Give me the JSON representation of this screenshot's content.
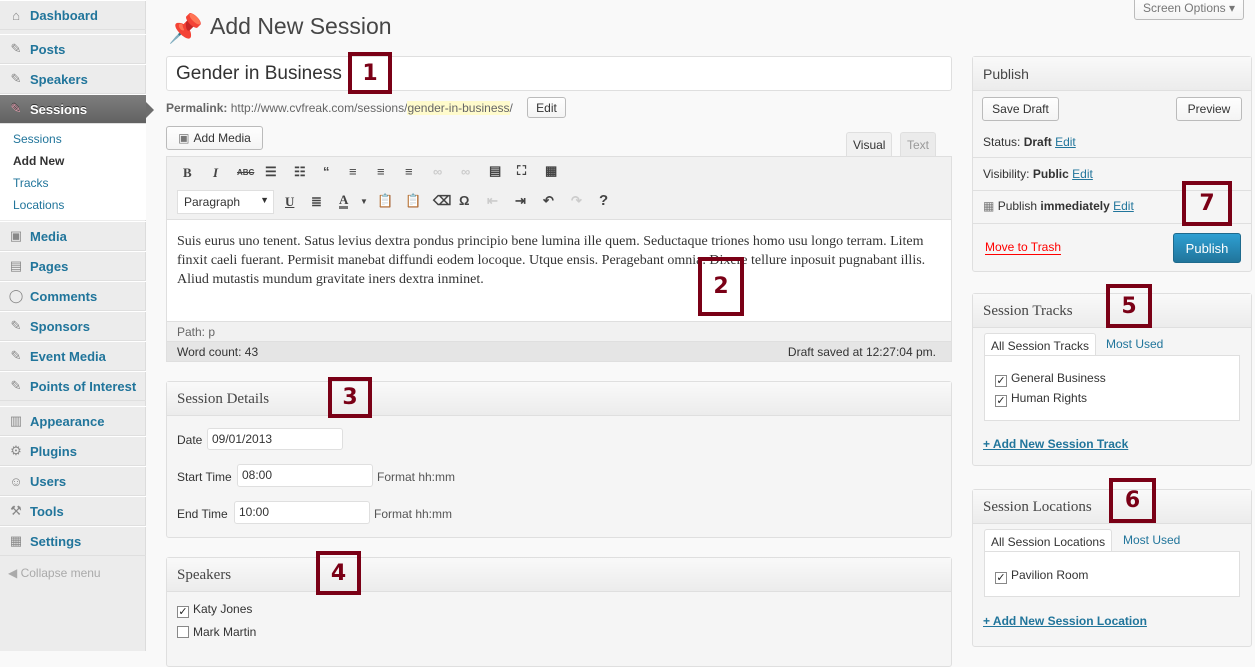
{
  "sidebar": {
    "items": [
      {
        "label": "Dashboard",
        "icon": "house-icon"
      },
      {
        "label": "Posts",
        "icon": "pin-icon"
      },
      {
        "label": "Speakers",
        "icon": "pin-icon"
      },
      {
        "label": "Sessions",
        "icon": "pin-icon"
      },
      {
        "label": "Media",
        "icon": "media-icon"
      },
      {
        "label": "Pages",
        "icon": "pages-icon"
      },
      {
        "label": "Comments",
        "icon": "comment-icon"
      },
      {
        "label": "Sponsors",
        "icon": "pin-icon"
      },
      {
        "label": "Event Media",
        "icon": "pin-icon"
      },
      {
        "label": "Points of Interest",
        "icon": "pin-icon"
      },
      {
        "label": "Appearance",
        "icon": "appearance-icon"
      },
      {
        "label": "Plugins",
        "icon": "plugin-icon"
      },
      {
        "label": "Users",
        "icon": "users-icon"
      },
      {
        "label": "Tools",
        "icon": "tools-icon"
      },
      {
        "label": "Settings",
        "icon": "settings-icon"
      }
    ],
    "submenu": [
      "Sessions",
      "Add New",
      "Tracks",
      "Locations"
    ],
    "collapse": "Collapse menu"
  },
  "header": {
    "title": "Add New Session",
    "screen_options": "Screen Options"
  },
  "post": {
    "title": "Gender in Business",
    "permalink_label": "Permalink:",
    "permalink_base": "http://www.cvfreak.com/sessions/",
    "permalink_slug": "gender-in-business",
    "permalink_end": "/",
    "edit": "Edit"
  },
  "editor": {
    "add_media": "Add Media",
    "tab_visual": "Visual",
    "tab_text": "Text",
    "format": "Paragraph",
    "content": "Suis eurus uno tenent. Satus levius dextra pondus principio bene lumina ille quem. Seductaque triones homo usu longo terram. Litem finxit caeli fuerant. Permisit manebat diffundi eodem locoque. Utque ensis. Peragebant omnia. Dixere tellure inposuit pugnabant illis. Aliud mutastis mundum gravitate iners dextra inminet.",
    "path": "Path: p",
    "word_count": "Word count: 43",
    "draft_saved": "Draft saved at 12:27:04 pm."
  },
  "session_details": {
    "title": "Session Details",
    "date_label": "Date",
    "date": "09/01/2013",
    "start_label": "Start Time",
    "start": "08:00",
    "end_label": "End Time",
    "end": "10:00",
    "format": "Format hh:mm"
  },
  "speakers": {
    "title": "Speakers",
    "items": [
      {
        "label": "Katy Jones",
        "checked": true
      },
      {
        "label": "Mark Martin",
        "checked": false
      }
    ]
  },
  "publish": {
    "title": "Publish",
    "save_draft": "Save Draft",
    "preview": "Preview",
    "status_label": "Status:",
    "status": "Draft",
    "visibility_label": "Visibility:",
    "visibility": "Public",
    "publish_label": "Publish",
    "publish_when": "immediately",
    "edit": "Edit",
    "trash": "Move to Trash",
    "publish_button": "Publish"
  },
  "tracks": {
    "title": "Session Tracks",
    "tab_all": "All Session Tracks",
    "tab_most": "Most Used",
    "items": [
      {
        "label": "General Business",
        "checked": true
      },
      {
        "label": "Human Rights",
        "checked": true
      }
    ],
    "add": "+ Add New Session Track"
  },
  "locations": {
    "title": "Session Locations",
    "tab_all": "All Session Locations",
    "tab_most": "Most Used",
    "items": [
      {
        "label": "Pavilion Room",
        "checked": true
      }
    ],
    "add": "+ Add New Session Location"
  },
  "annotations": [
    "1",
    "2",
    "3",
    "4",
    "5",
    "6",
    "7"
  ],
  "colors": {
    "annotation": "#7a0016",
    "publish": "#2a8bbd",
    "link": "#21759b"
  }
}
